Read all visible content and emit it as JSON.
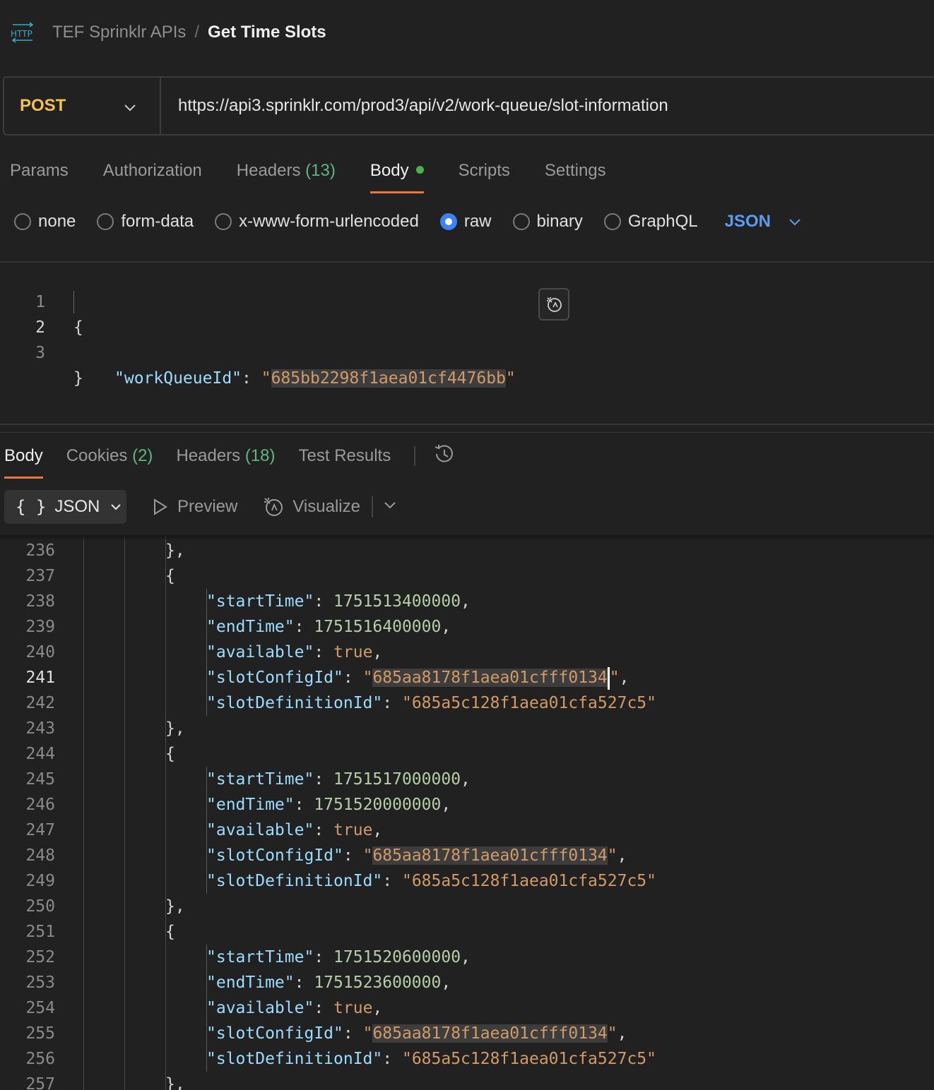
{
  "breadcrumb": {
    "icon": "http-icon",
    "parent": "TEF Sprinklr APIs",
    "separator": "/",
    "current": "Get Time Slots"
  },
  "request": {
    "method": "POST",
    "url": "https://api3.sprinklr.com/prod3/api/v2/work-queue/slot-information"
  },
  "request_tabs": {
    "params": "Params",
    "authorization": "Authorization",
    "headers": "Headers",
    "headers_count": "(13)",
    "body": "Body",
    "scripts": "Scripts",
    "settings": "Settings"
  },
  "body_types": {
    "none": "none",
    "form_data": "form-data",
    "urlencoded": "x-www-form-urlencoded",
    "raw": "raw",
    "binary": "binary",
    "graphql": "GraphQL",
    "selected": "raw",
    "language": "JSON"
  },
  "request_body": {
    "lines": [
      {
        "n": "1",
        "open": "{"
      },
      {
        "n": "2",
        "key": "\"workQueueId\"",
        "colon": ": ",
        "q1": "\"",
        "value": "685bb2298f1aea01cf4476bb",
        "q2": "\""
      },
      {
        "n": "3",
        "close": "}"
      }
    ]
  },
  "response_tabs": {
    "body": "Body",
    "cookies": "Cookies",
    "cookies_count": "(2)",
    "headers": "Headers",
    "headers_count": "(18)",
    "test_results": "Test Results"
  },
  "response_toolbar": {
    "format_braces": "{ }",
    "format": "JSON",
    "preview": "Preview",
    "visualize": "Visualize"
  },
  "response_body": {
    "current_line": "241",
    "lines": [
      {
        "n": "236",
        "indent": 2,
        "t": "close",
        "p": "},"
      },
      {
        "n": "237",
        "indent": 2,
        "t": "open",
        "p": "{"
      },
      {
        "n": "238",
        "indent": 3,
        "t": "kv",
        "k": "\"startTime\"",
        "v": "1751513400000",
        "vt": "num",
        "c": ","
      },
      {
        "n": "239",
        "indent": 3,
        "t": "kv",
        "k": "\"endTime\"",
        "v": "1751516400000",
        "vt": "num",
        "c": ","
      },
      {
        "n": "240",
        "indent": 3,
        "t": "kv",
        "k": "\"available\"",
        "v": "true",
        "vt": "bool",
        "c": ","
      },
      {
        "n": "241",
        "indent": 3,
        "t": "kv",
        "k": "\"slotConfigId\"",
        "v": "685aa8178f1aea01cfff0134",
        "vt": "strhl",
        "c": ",",
        "cursor": true
      },
      {
        "n": "242",
        "indent": 3,
        "t": "kv",
        "k": "\"slotDefinitionId\"",
        "v": "685a5c128f1aea01cfa527c5",
        "vt": "str",
        "c": ""
      },
      {
        "n": "243",
        "indent": 2,
        "t": "close",
        "p": "},"
      },
      {
        "n": "244",
        "indent": 2,
        "t": "open",
        "p": "{"
      },
      {
        "n": "245",
        "indent": 3,
        "t": "kv",
        "k": "\"startTime\"",
        "v": "1751517000000",
        "vt": "num",
        "c": ","
      },
      {
        "n": "246",
        "indent": 3,
        "t": "kv",
        "k": "\"endTime\"",
        "v": "1751520000000",
        "vt": "num",
        "c": ","
      },
      {
        "n": "247",
        "indent": 3,
        "t": "kv",
        "k": "\"available\"",
        "v": "true",
        "vt": "bool",
        "c": ","
      },
      {
        "n": "248",
        "indent": 3,
        "t": "kv",
        "k": "\"slotConfigId\"",
        "v": "685aa8178f1aea01cfff0134",
        "vt": "strhl",
        "c": ","
      },
      {
        "n": "249",
        "indent": 3,
        "t": "kv",
        "k": "\"slotDefinitionId\"",
        "v": "685a5c128f1aea01cfa527c5",
        "vt": "str",
        "c": ""
      },
      {
        "n": "250",
        "indent": 2,
        "t": "close",
        "p": "},"
      },
      {
        "n": "251",
        "indent": 2,
        "t": "open",
        "p": "{"
      },
      {
        "n": "252",
        "indent": 3,
        "t": "kv",
        "k": "\"startTime\"",
        "v": "1751520600000",
        "vt": "num",
        "c": ","
      },
      {
        "n": "253",
        "indent": 3,
        "t": "kv",
        "k": "\"endTime\"",
        "v": "1751523600000",
        "vt": "num",
        "c": ","
      },
      {
        "n": "254",
        "indent": 3,
        "t": "kv",
        "k": "\"available\"",
        "v": "true",
        "vt": "bool",
        "c": ","
      },
      {
        "n": "255",
        "indent": 3,
        "t": "kv",
        "k": "\"slotConfigId\"",
        "v": "685aa8178f1aea01cfff0134",
        "vt": "strhl",
        "c": ","
      },
      {
        "n": "256",
        "indent": 3,
        "t": "kv",
        "k": "\"slotDefinitionId\"",
        "v": "685a5c128f1aea01cfa527c5",
        "vt": "str",
        "c": ""
      },
      {
        "n": "257",
        "indent": 2,
        "t": "close",
        "p": "},"
      }
    ]
  },
  "colors": {
    "background": "#212121",
    "method": "#f2c14e",
    "active_tab_underline": "#e8783f",
    "count": "#5fb483",
    "accent_blue": "#3b82f6",
    "json_key": "#9cdcfe",
    "json_string": "#d19a66",
    "json_number": "#b5cea8"
  }
}
